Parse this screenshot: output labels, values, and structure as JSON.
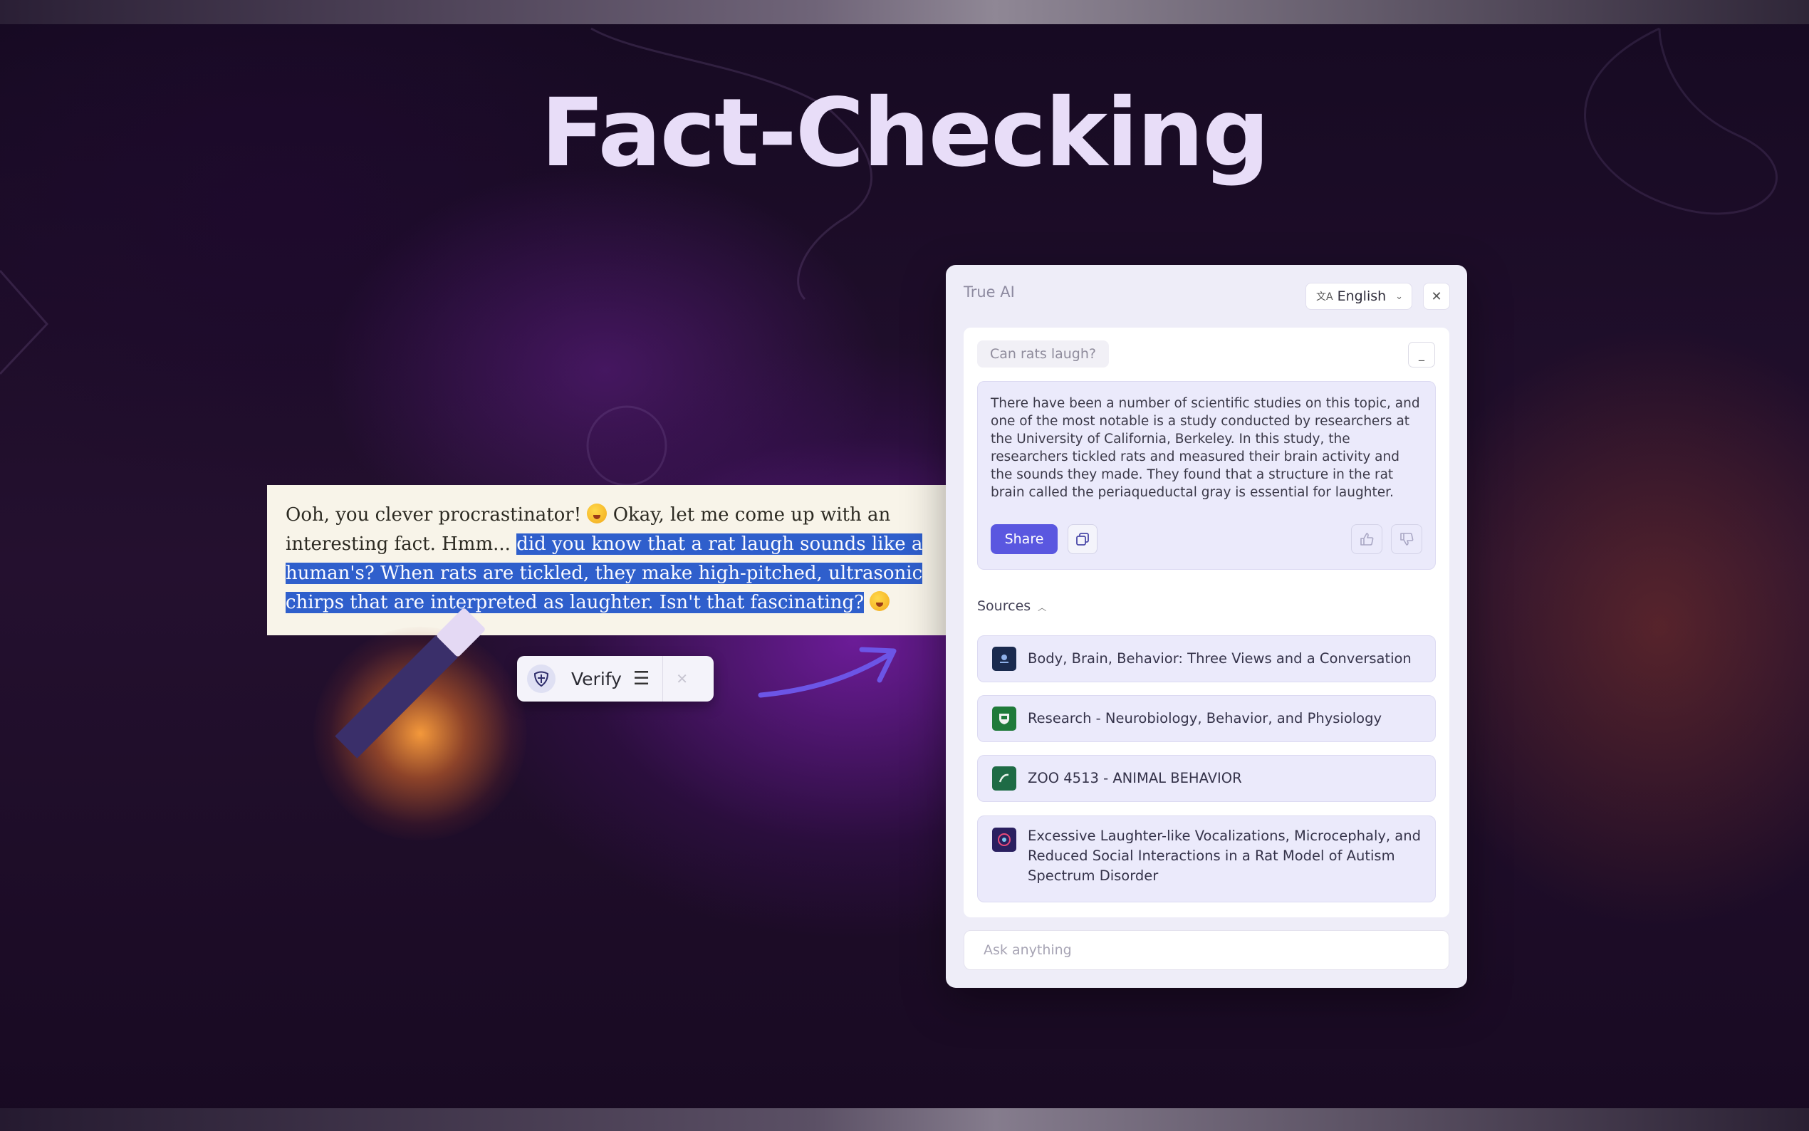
{
  "page": {
    "title": "Fact-Checking"
  },
  "chat_message": {
    "plain": "Ooh, you clever procrastinator! ",
    "mid": " Okay, let me come up with an interesting fact. Hmm... ",
    "highlighted": "did you know that a rat laugh sounds like a human's? When rats are tickled, they make high-pitched, ultrasonic chirps that are interpreted as laughter. Isn't that fascinating?",
    "highlight_color": "#2f5fcc"
  },
  "verify_toolbar": {
    "label": "Verify",
    "menu_icon": "hamburger-icon",
    "close_icon": "close-icon"
  },
  "panel": {
    "title": "True AI",
    "language": "English",
    "question": "Can rats laugh?",
    "answer": "There have been a number of scientific studies on this topic, and one of the most notable is a study conducted by researchers at the University of California, Berkeley. In this study, the researchers tickled rats and measured their brain activity and the sounds they made. They found that a structure in the rat brain called the periaqueductal gray is essential for laughter.",
    "share_label": "Share",
    "sources_label": "Sources",
    "sources": [
      {
        "title": "Body, Brain, Behavior: Three Views and a Conversation",
        "icon_color": "#1a2a4e"
      },
      {
        "title": "Research - Neurobiology, Behavior, and Physiology",
        "icon_color": "#1f7a3a"
      },
      {
        "title": "ZOO 4513 - ANIMAL BEHAVIOR",
        "icon_color": "#1e6b45"
      },
      {
        "title": "Excessive Laughter-like Vocalizations, Microcephaly, and Reduced Social Interactions in a Rat Model of Autism Spectrum Disorder",
        "icon_color": "#2a2060"
      }
    ],
    "ask_placeholder": "Ask anything",
    "accent_color": "#5a57e0"
  }
}
